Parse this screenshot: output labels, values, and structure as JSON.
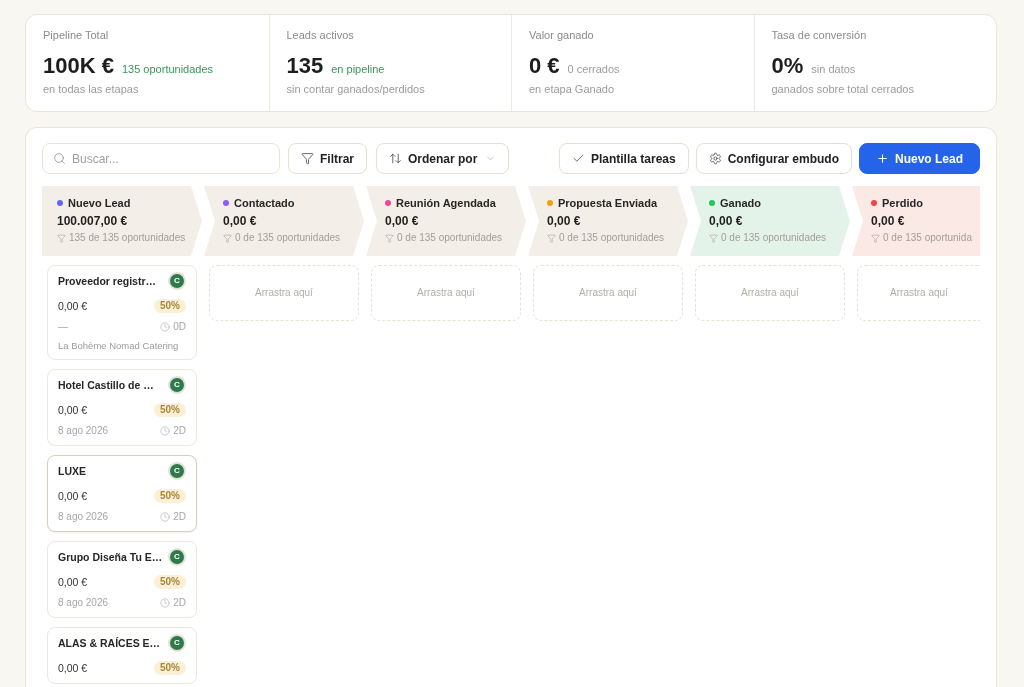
{
  "stats": [
    {
      "label": "Pipeline Total",
      "value": "100K €",
      "note": {
        "text": "135 oportunidades",
        "kind": "positive"
      },
      "caption": "en todas las etapas"
    },
    {
      "label": "Leads activos",
      "value": "135",
      "note": {
        "text": "en pipeline",
        "kind": "positive"
      },
      "caption": "sin contar ganados/perdidos"
    },
    {
      "label": "Valor ganado",
      "value": "0 €",
      "note": {
        "text": "0 cerrados",
        "kind": "neutral"
      },
      "caption": "en etapa Ganado"
    },
    {
      "label": "Tasa de conversión",
      "value": "0%",
      "note": {
        "text": "sin datos",
        "kind": "neutral"
      },
      "caption": "ganados sobre total cerrados"
    }
  ],
  "toolbar": {
    "search": {
      "placeholder": "Buscar..."
    },
    "left_buttons": [
      {
        "label": "Filtrar",
        "kind": "filter"
      },
      {
        "label": "Ordenar por",
        "kind": "sort"
      }
    ],
    "right_buttons": [
      {
        "label": "Plantilla tareas",
        "kind": "tasks"
      },
      {
        "label": "Configurar embudo",
        "kind": "settings"
      },
      {
        "label": "Nuevo Lead",
        "kind": "primary"
      }
    ]
  },
  "stages": [
    {
      "name": "Nuevo Lead",
      "color": "#6366f1",
      "kind": "open",
      "total": "100.007,00 €",
      "count": "135 de 135 oportunidades",
      "cards": [
        {
          "title": "Proveedor registr…",
          "avatar": "C",
          "amount": "0,00 €",
          "probability": "50%",
          "date": "—",
          "age": "0D",
          "company": "La Bohème Nomad Catering",
          "selected": false
        },
        {
          "title": "Hotel Castillo de …",
          "avatar": "C",
          "amount": "0,00 €",
          "probability": "50%",
          "date": "8 ago 2026",
          "age": "2D",
          "selected": false
        },
        {
          "title": "LUXE",
          "avatar": "C",
          "amount": "0,00 €",
          "probability": "50%",
          "date": "8 ago 2026",
          "age": "2D",
          "selected": true
        },
        {
          "title": "Grupo Diseña Tu E…",
          "avatar": "C",
          "amount": "0,00 €",
          "probability": "50%",
          "date": "8 ago 2026",
          "age": "2D",
          "selected": false
        },
        {
          "title": "ALAS & RAÍCES E…",
          "avatar": "C",
          "amount": "0,00 €",
          "probability": "50%",
          "selected": false
        }
      ]
    },
    {
      "name": "Contactado",
      "color": "#8b5cf6",
      "kind": "open",
      "total": "0,00 €",
      "count": "0 de 135 oportunidades",
      "empty_text": "Arrastra aquí"
    },
    {
      "name": "Reunión Agendada",
      "color": "#ec4899",
      "kind": "open",
      "total": "0,00 €",
      "count": "0 de 135 oportunidades",
      "empty_text": "Arrastra aquí"
    },
    {
      "name": "Propuesta Enviada",
      "color": "#f59e0b",
      "kind": "open",
      "total": "0,00 €",
      "count": "0 de 135 oportunidades",
      "empty_text": "Arrastra aquí"
    },
    {
      "name": "Ganado",
      "color": "#22c55e",
      "kind": "won",
      "total": "0,00 €",
      "count": "0 de 135 oportunidades",
      "empty_text": "Arrastra aquí"
    },
    {
      "name": "Perdido",
      "color": "#ef4444",
      "kind": "lost",
      "total": "0,00 €",
      "count": "0 de 135 oportunida",
      "empty_text": "Arrastra aquí"
    }
  ]
}
